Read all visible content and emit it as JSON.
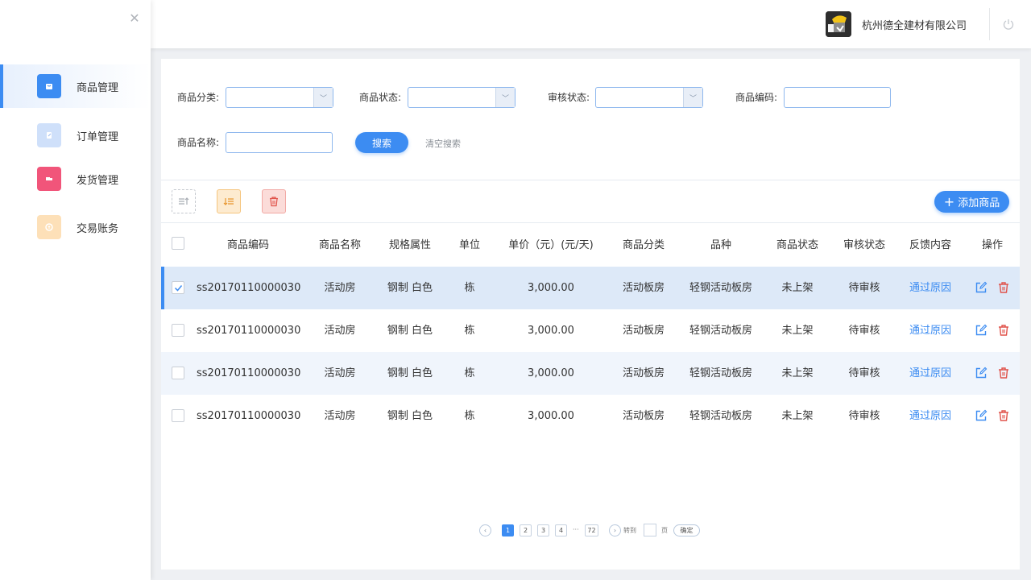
{
  "sidebar": {
    "items": [
      {
        "label": "商品管理",
        "icon": "bag-icon",
        "color": "#3c8cf2"
      },
      {
        "label": "订单管理",
        "icon": "order-icon",
        "color": "#cfe0fa"
      },
      {
        "label": "发货管理",
        "icon": "truck-icon",
        "color": "#f1557a"
      },
      {
        "label": "交易账务",
        "icon": "coin-icon",
        "color": "#fde0b8"
      }
    ]
  },
  "header": {
    "company": "杭州德全建材有限公司"
  },
  "filters": {
    "category_label": "商品分类:",
    "status_label": "商品状态:",
    "audit_label": "审核状态:",
    "code_label": "商品编码:",
    "name_label": "商品名称:",
    "search_button": "搜索",
    "clear_link": "清空搜索"
  },
  "toolbar": {
    "add_button": "添加商品"
  },
  "table": {
    "headers": [
      "商品编码",
      "商品名称",
      "规格属性",
      "单位",
      "单价（元）(元/天)",
      "商品分类",
      "品种",
      "商品状态",
      "审核状态",
      "反馈内容",
      "操作"
    ],
    "rows": [
      {
        "code": "ss20170110000030",
        "name": "活动房",
        "spec": "钢制  白色",
        "unit": "栋",
        "price": "3,000.00",
        "category": "活动板房",
        "variety": "轻钢活动板房",
        "status": "未上架",
        "audit": "待审核",
        "feedback": "通过原因",
        "checked": true
      },
      {
        "code": "ss20170110000030",
        "name": "活动房",
        "spec": "钢制  白色",
        "unit": "栋",
        "price": "3,000.00",
        "category": "活动板房",
        "variety": "轻钢活动板房",
        "status": "未上架",
        "audit": "待审核",
        "feedback": "通过原因",
        "checked": false
      },
      {
        "code": "ss20170110000030",
        "name": "活动房",
        "spec": "钢制  白色",
        "unit": "栋",
        "price": "3,000.00",
        "category": "活动板房",
        "variety": "轻钢活动板房",
        "status": "未上架",
        "audit": "待审核",
        "feedback": "通过原因",
        "checked": false
      },
      {
        "code": "ss20170110000030",
        "name": "活动房",
        "spec": "钢制  白色",
        "unit": "栋",
        "price": "3,000.00",
        "category": "活动板房",
        "variety": "轻钢活动板房",
        "status": "未上架",
        "audit": "待审核",
        "feedback": "通过原因",
        "checked": false
      }
    ]
  },
  "pagination": {
    "pages": [
      "1",
      "2",
      "3",
      "4"
    ],
    "ellipsis": "···",
    "last": "72",
    "goto_label": "转到",
    "page_label": "页",
    "confirm": "确定"
  }
}
